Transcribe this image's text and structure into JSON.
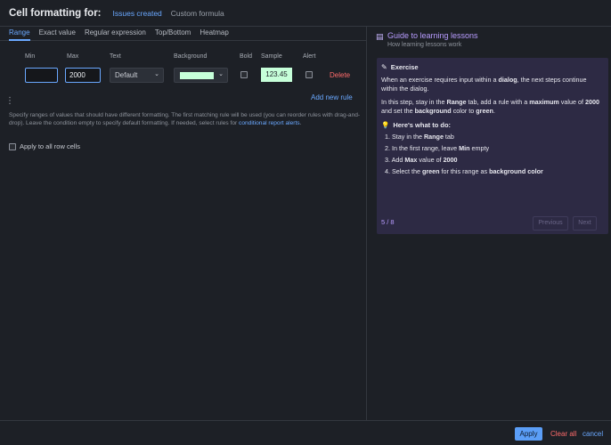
{
  "header": {
    "title": "Cell formatting for:",
    "tabs": [
      {
        "label": "Issues created",
        "active": true
      },
      {
        "label": "Custom formula",
        "active": false
      }
    ]
  },
  "subtabs": [
    {
      "label": "Range",
      "active": true
    },
    {
      "label": "Exact value",
      "active": false
    },
    {
      "label": "Regular expression",
      "active": false
    },
    {
      "label": "Top/Bottom",
      "active": false
    },
    {
      "label": "Heatmap",
      "active": false
    }
  ],
  "table": {
    "columns": [
      "Min",
      "Max",
      "Text",
      "Background",
      "Bold",
      "Sample",
      "Alert"
    ],
    "row": {
      "min": "",
      "max": "2000",
      "text_select": "Default",
      "background_color": "#c6ffd9",
      "bold": false,
      "sample": "123.45",
      "alert": false,
      "delete_label": "Delete"
    }
  },
  "add_rule_label": "Add new rule",
  "help": {
    "text": "Specify ranges of values that should have different formatting. The first matching rule will be used (you can reorder rules with drag-and-drop). Leave the condition empty to specify default formatting. If needed, select rules for ",
    "link": "conditional report alerts",
    "tail": "."
  },
  "apply_all_label": "Apply to all row cells",
  "guide": {
    "title": "Guide to learning lessons",
    "subtitle": "How learning lessons work",
    "exercise_heading": "Exercise",
    "p1_a": "When an exercise requires input within a ",
    "p1_b": "dialog",
    "p1_c": ", the next steps continue within the dialog.",
    "p2_a": "In this step, stay in the ",
    "p2_b": "Range",
    "p2_c": " tab, add a rule with a ",
    "p2_d": "maximum",
    "p2_e": " value of ",
    "p2_f": "2000",
    "p2_g": " and set the ",
    "p2_h": "background",
    "p2_i": " color to ",
    "p2_j": "green",
    "p2_k": ".",
    "todo_heading": "Here's what to do:",
    "steps": [
      {
        "n": "1.",
        "a": "Stay in the ",
        "b": "Range",
        "c": " tab"
      },
      {
        "n": "2.",
        "a": "In the first range, leave ",
        "b": "Min",
        "c": " empty"
      },
      {
        "n": "3.",
        "a": "Add ",
        "b": "Max",
        "c": " value of ",
        "d": "2000"
      },
      {
        "n": "4.",
        "a": "Select the ",
        "b": "green",
        "c": " for this range as ",
        "d": "background color"
      }
    ],
    "pager": "5 / 8",
    "previous_label": "Previous",
    "next_label": "Next"
  },
  "footer": {
    "apply_label": "Apply",
    "clear_label": "Clear all",
    "cancel_label": "cancel"
  },
  "colors": {
    "accent": "#6aa8ff",
    "danger": "#ff6b6b",
    "guide_bg": "#2d2a44",
    "guide_accent": "#b89cff"
  }
}
